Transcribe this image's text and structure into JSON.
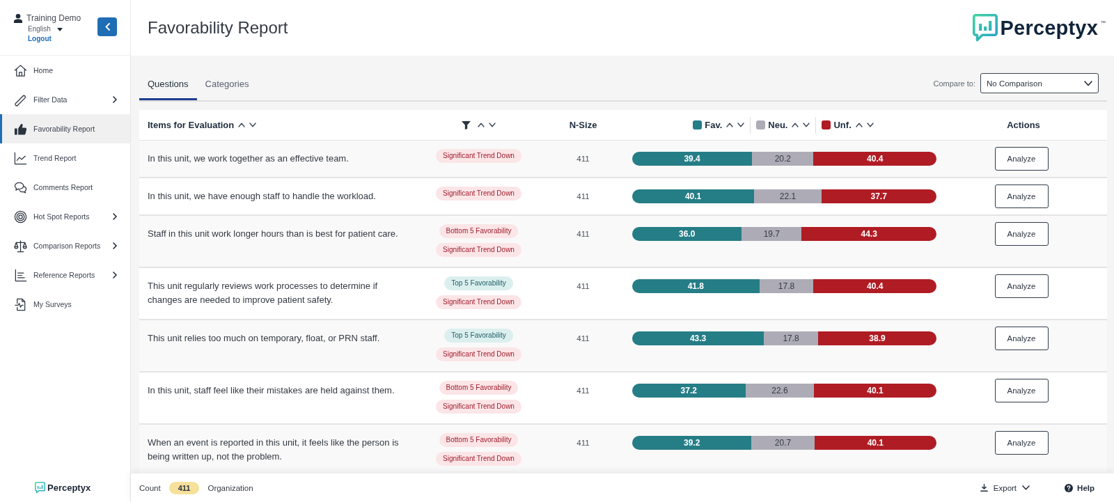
{
  "sidebar": {
    "user": {
      "name": "Training Demo",
      "language": "English",
      "logout": "Logout"
    },
    "items": [
      {
        "label": "Home",
        "expandable": false,
        "selected": false
      },
      {
        "label": "Filter Data",
        "expandable": true,
        "selected": false
      },
      {
        "label": "Favorability Report",
        "expandable": false,
        "selected": true
      },
      {
        "label": "Trend Report",
        "expandable": false,
        "selected": false
      },
      {
        "label": "Comments Report",
        "expandable": false,
        "selected": false
      },
      {
        "label": "Hot Spot Reports",
        "expandable": true,
        "selected": false
      },
      {
        "label": "Comparison Reports",
        "expandable": true,
        "selected": false
      },
      {
        "label": "Reference Reports",
        "expandable": true,
        "selected": false
      },
      {
        "label": "My Surveys",
        "expandable": false,
        "selected": false
      }
    ],
    "brand": "Perceptyx"
  },
  "header": {
    "title": "Favorability Report",
    "brand": "Perceptyx",
    "trademark": "™"
  },
  "tabs": [
    {
      "label": "Questions",
      "selected": true
    },
    {
      "label": "Categories",
      "selected": false
    }
  ],
  "compare": {
    "label": "Compare to:",
    "value": "No Comparison"
  },
  "table": {
    "columns": [
      {
        "kind": "text",
        "label": "Items for Evaluation",
        "sortable": true
      },
      {
        "kind": "filter",
        "sortable": true
      },
      {
        "kind": "text",
        "label": "N-Size",
        "sortable": false
      },
      {
        "kind": "legend",
        "series": [
          {
            "label": "Fav.",
            "color": "#257d86",
            "sortable": true
          },
          {
            "label": "Neu.",
            "color": "#adacb6",
            "sortable": true
          },
          {
            "label": "Unf.",
            "color": "#b01c24",
            "sortable": true
          }
        ]
      },
      {
        "kind": "text",
        "label": "Actions",
        "sortable": false
      }
    ],
    "rows": [
      {
        "item": "In this unit, we work together as an effective team.",
        "badges": [
          {
            "label": "Significant Trend Down",
            "kind": "negative"
          }
        ],
        "n_size": "411",
        "segments": [
          {
            "value": "39.4"
          },
          {
            "value": "20.2"
          },
          {
            "value": "40.4"
          }
        ],
        "action": "Analyze"
      },
      {
        "item": "In this unit, we have enough staff to handle the workload.",
        "badges": [
          {
            "label": "Significant Trend Down",
            "kind": "negative"
          }
        ],
        "n_size": "411",
        "segments": [
          {
            "value": "40.1"
          },
          {
            "value": "22.1"
          },
          {
            "value": "37.7"
          }
        ],
        "action": "Analyze"
      },
      {
        "item": "Staff in this unit work longer hours than is best for patient care.",
        "badges": [
          {
            "label": "Bottom 5 Favorability",
            "kind": "negative"
          },
          {
            "label": "Significant Trend Down",
            "kind": "negative"
          }
        ],
        "n_size": "411",
        "segments": [
          {
            "value": "36.0"
          },
          {
            "value": "19.7"
          },
          {
            "value": "44.3"
          }
        ],
        "action": "Analyze"
      },
      {
        "item": "This unit regularly reviews work processes to determine if changes are needed to improve patient safety.",
        "badges": [
          {
            "label": "Top 5 Favorability",
            "kind": "positive"
          },
          {
            "label": "Significant Trend Down",
            "kind": "negative"
          }
        ],
        "n_size": "411",
        "segments": [
          {
            "value": "41.8"
          },
          {
            "value": "17.8"
          },
          {
            "value": "40.4"
          }
        ],
        "action": "Analyze"
      },
      {
        "item": "This unit relies too much on temporary, float, or PRN staff.",
        "badges": [
          {
            "label": "Top 5 Favorability",
            "kind": "positive"
          },
          {
            "label": "Significant Trend Down",
            "kind": "negative"
          }
        ],
        "n_size": "411",
        "segments": [
          {
            "value": "43.3"
          },
          {
            "value": "17.8"
          },
          {
            "value": "38.9"
          }
        ],
        "action": "Analyze"
      },
      {
        "item": "In this unit, staff feel like their mistakes are held against them.",
        "badges": [
          {
            "label": "Bottom 5 Favorability",
            "kind": "negative"
          },
          {
            "label": "Significant Trend Down",
            "kind": "negative"
          }
        ],
        "n_size": "411",
        "segments": [
          {
            "value": "37.2"
          },
          {
            "value": "22.6"
          },
          {
            "value": "40.1"
          }
        ],
        "action": "Analyze"
      },
      {
        "item": "When an event is reported in this unit, it feels like the person is being written up, not the problem.",
        "badges": [
          {
            "label": "Bottom 5 Favorability",
            "kind": "negative"
          },
          {
            "label": "Significant Trend Down",
            "kind": "negative"
          }
        ],
        "n_size": "411",
        "segments": [
          {
            "value": "39.2"
          },
          {
            "value": "20.7"
          },
          {
            "value": "40.1"
          }
        ],
        "action": "Analyze"
      }
    ]
  },
  "status_bar": {
    "count_label": "Count",
    "count": "411",
    "scope": "Organization",
    "export": "Export",
    "help": "Help"
  }
}
